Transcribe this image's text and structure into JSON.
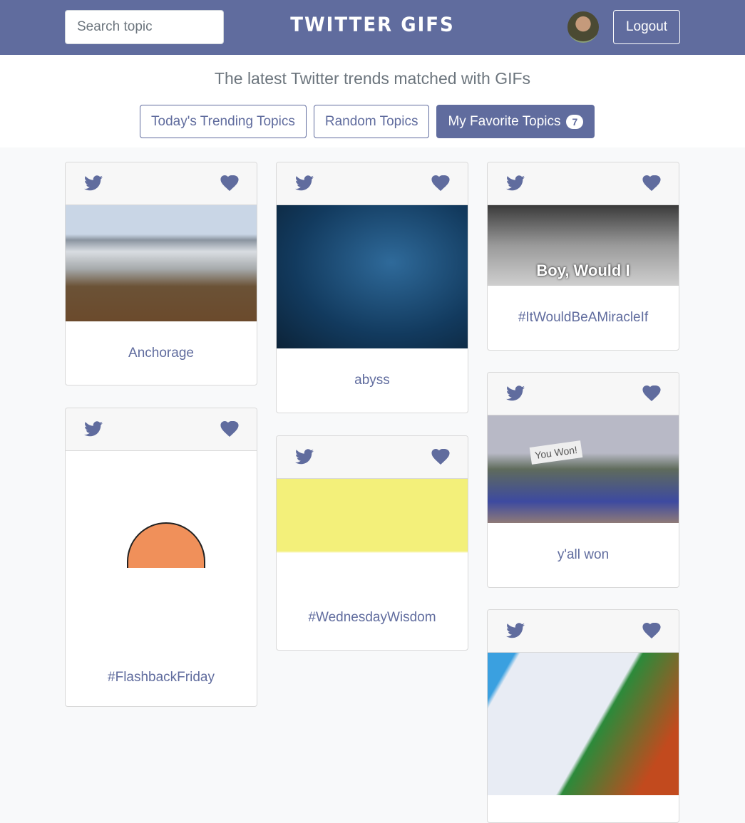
{
  "header": {
    "search_placeholder": "Search topic",
    "brand": "TWITTER GIFS",
    "logout_label": "Logout"
  },
  "tagline": "The latest Twitter trends matched with GIFs",
  "tabs": [
    {
      "label": "Today's Trending Topics"
    },
    {
      "label": "Random Topics"
    },
    {
      "label": "My Favorite Topics",
      "badge": "7"
    }
  ],
  "cards": [
    {
      "title": "Anchorage"
    },
    {
      "title": "#FlashbackFriday"
    },
    {
      "title": "abyss"
    },
    {
      "title": "#WednesdayWisdom"
    },
    {
      "title": "#ItWouldBeAMiracleIf",
      "gif_caption": "Boy, Would I"
    },
    {
      "title": "y'all won",
      "gif_caption": "You Won!"
    },
    {
      "title": ""
    }
  ],
  "colors": {
    "primary": "#606c9e"
  }
}
